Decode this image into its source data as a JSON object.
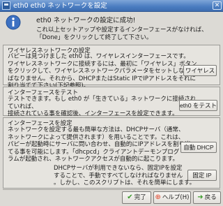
{
  "window": {
    "title": "eth0 eth0 ネットワークを設定",
    "close_glyph": "✕"
  },
  "header": {
    "title": "eth0 ネットワークの設定に成功!",
    "instructions": "これ以上セットアップや設定するインターフェースがなければ、\n「Done」をクリックして終了して下さい。"
  },
  "wireless": {
    "heading": "ワイヤレスネットワークの設定",
    "text": "バピーは見つけました eth0 は、ワイヤレスインターフェースです。\nワイヤレスネットワークに接続するには、最初に「ワイヤレス」ボタン\nをクリックして、ワイヤレスネットワークパラメータをセットしなけれ\nばなりません。それから、DHCPまたはStatic IPでIPアドレスをそれに\n割り当てて下さい(下記参照)。",
    "button_label": "ワイヤレス"
  },
  "test": {
    "heading": "インターフェースをテスト",
    "text": "テストできます。もし eth0 が「生きている」ネットワークに接続され\nていれば、\n接続されている事を確認後、インターフェースを設定できます。",
    "button_label": "eth0 をテスト"
  },
  "configure": {
    "heading": "インターフェースを設定",
    "text": "ネットワークを設定する最も簡単な方法は、DHCPサーバ（通常、\nネットワークによって提供されます）を用いることです。これは、\nパピーが起動時にサーバに問い合わせ、自動的にIPアドレスを割り当\nてる事を可能にします。「dhcpcd」クライアントデーモンプログ\nラムが起動され、ネットワークアクセスが自動的に起こります。",
    "dhcp_button": "自動 DHCP",
    "static_text": "DHCPサーバが利用できないなら、固定IPを設定\nすることで、手動ですべてしなければなりません\n。しかし、このスクリプトは、それを簡単にします。",
    "static_button": "固定 IP"
  },
  "footer": {
    "done_label": "完了",
    "help_label": "ヘルプ(H)",
    "back_label": "戻る"
  },
  "colors": {
    "titlebar": "#4a7cc0",
    "background": "#dcdad5",
    "done_icon": "#3a9a2a",
    "help_icon": "#e0442a",
    "back_icon": "#3a9a2a"
  }
}
